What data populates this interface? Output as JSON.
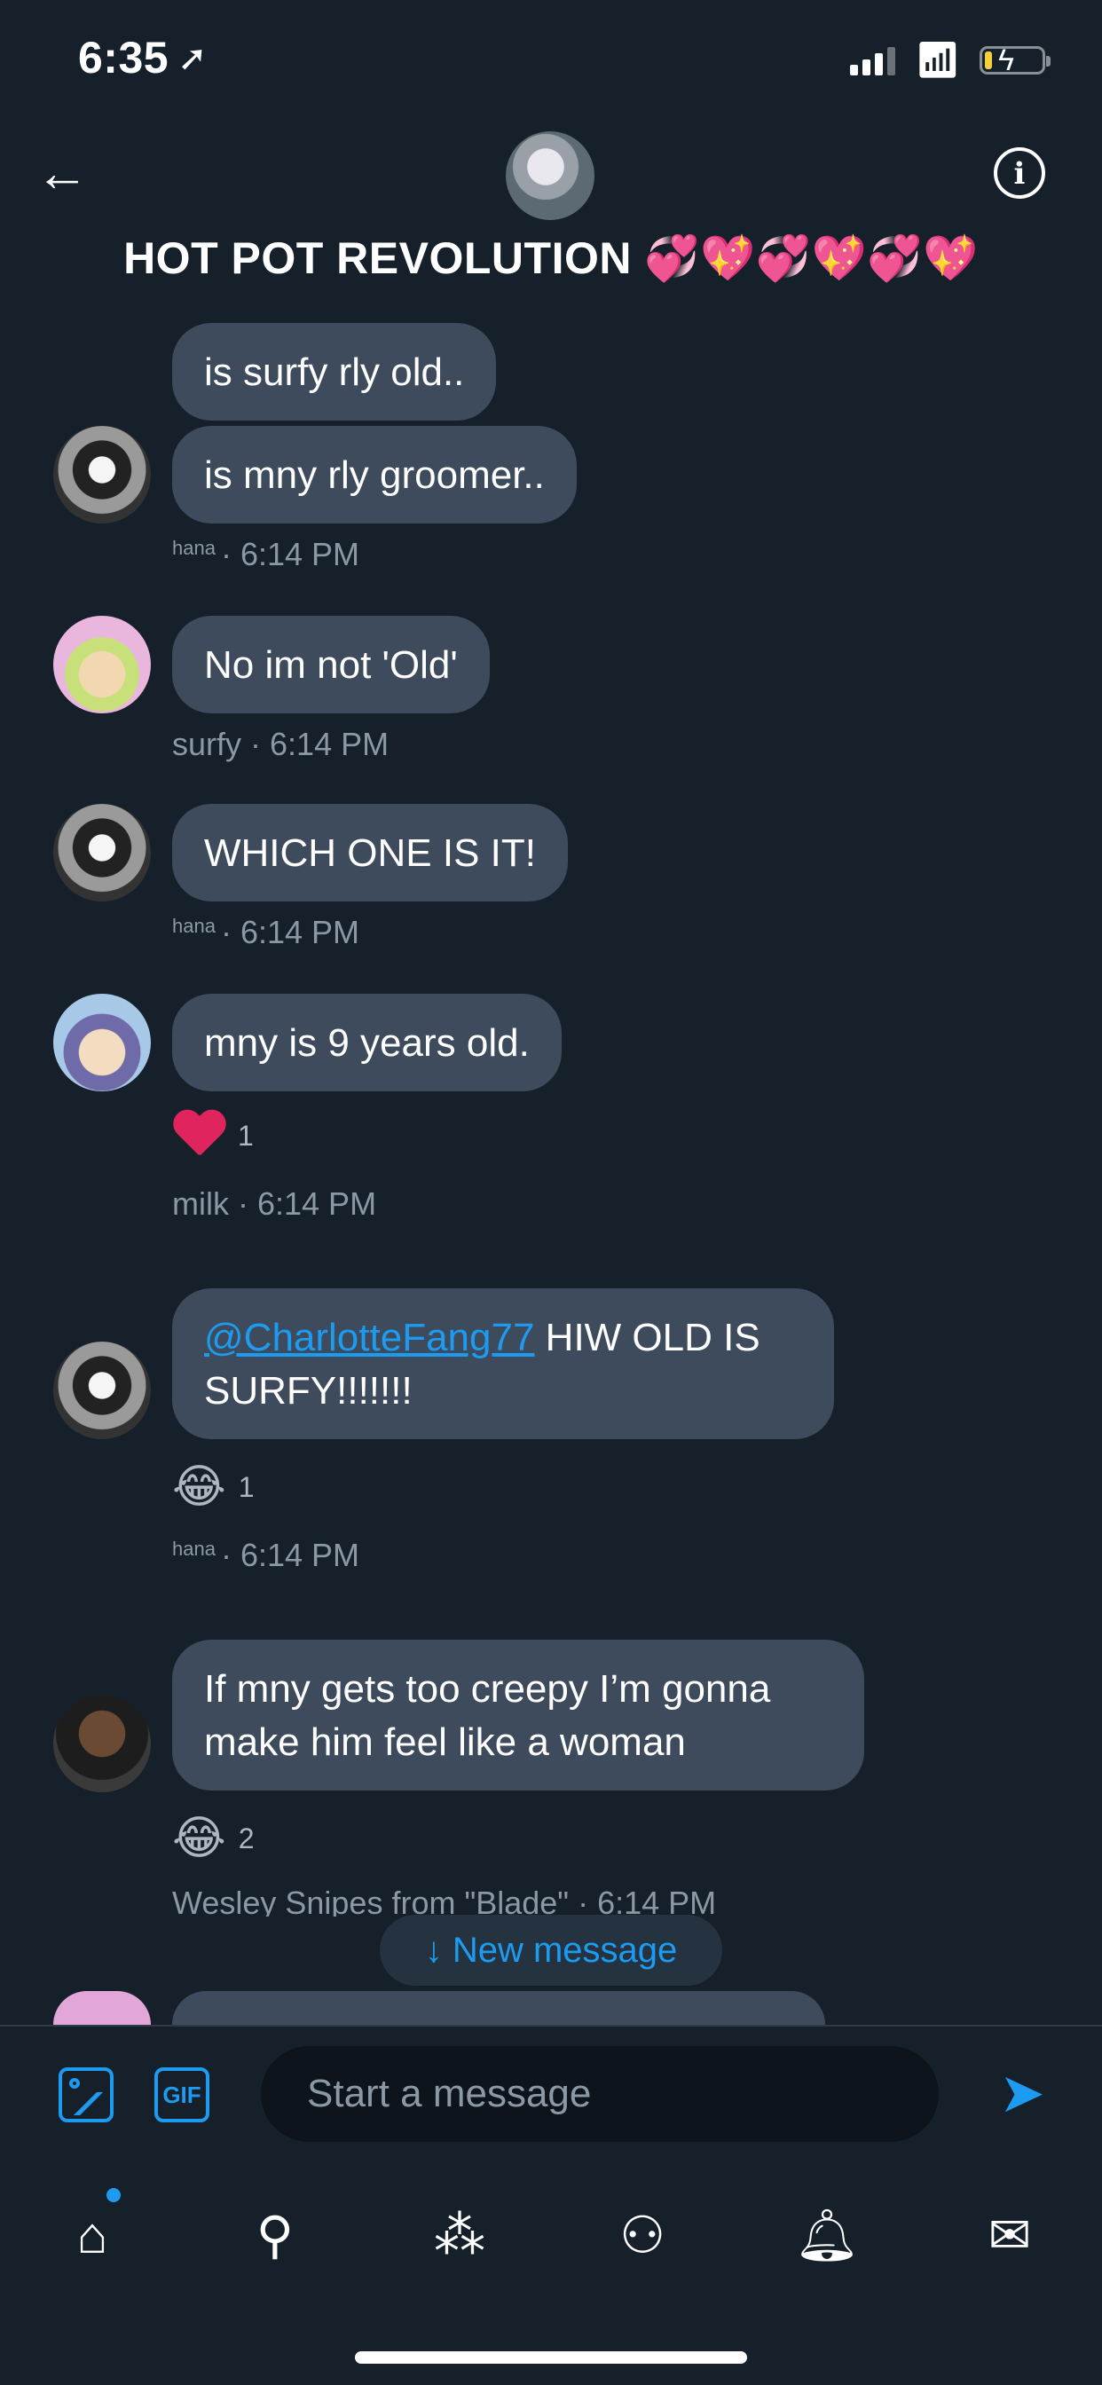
{
  "status_bar": {
    "time": "6:35"
  },
  "header": {
    "back_icon": "arrow-left-icon",
    "title": "HOT POT REVOLUTION 💞💖💞💖💞💖",
    "info_icon": "info-icon"
  },
  "messages": [
    {
      "author": "hana",
      "texts": [
        "is surfy rly old..",
        "is mny rly groomer.."
      ],
      "meta_author": "hana",
      "time": "· 6:14 PM"
    },
    {
      "author": "surfy",
      "texts": [
        "No im not 'Old'"
      ],
      "meta_author": "surfy",
      "time": "· 6:14 PM"
    },
    {
      "author": "hana",
      "texts": [
        "WHICH ONE IS IT!"
      ],
      "meta_author": "hana",
      "time": "· 6:14 PM"
    },
    {
      "author": "milk",
      "texts": [
        "mny is 9 years old."
      ],
      "reaction": {
        "emoji": "heart",
        "count": "1"
      },
      "meta_author": "milk",
      "time": "· 6:14 PM"
    },
    {
      "author": "hana",
      "mention": "@CharlotteFang77",
      "text_after_mention": " HIW OLD IS SURFY!!!!!!!",
      "reaction": {
        "emoji": "😂",
        "count": "1"
      },
      "meta_author": "hana",
      "time": "· 6:14 PM"
    },
    {
      "author": "Wesley Snipes from \"Blade\"",
      "texts": [
        "If mny gets too creepy I’m gonna make him feel like a woman"
      ],
      "reaction": {
        "emoji": "😂",
        "count": "2"
      },
      "meta_author": "Wesley Snipes from \"Blade\"",
      "time": "· 6:14 PM"
    }
  ],
  "new_message_pill": "↓ New message",
  "composer": {
    "image_icon": "image-icon",
    "gif_label": "GIF",
    "placeholder": "Start a message",
    "send_icon": "send-icon"
  },
  "tab_bar": {
    "items": [
      "home-icon",
      "search-icon",
      "spaces-icon",
      "communities-icon",
      "notifications-icon",
      "messages-icon"
    ]
  },
  "colors": {
    "background": "#15202b",
    "bubble": "#3d4b5c",
    "accent": "#1d9bf0",
    "meta": "#8b98a5"
  }
}
